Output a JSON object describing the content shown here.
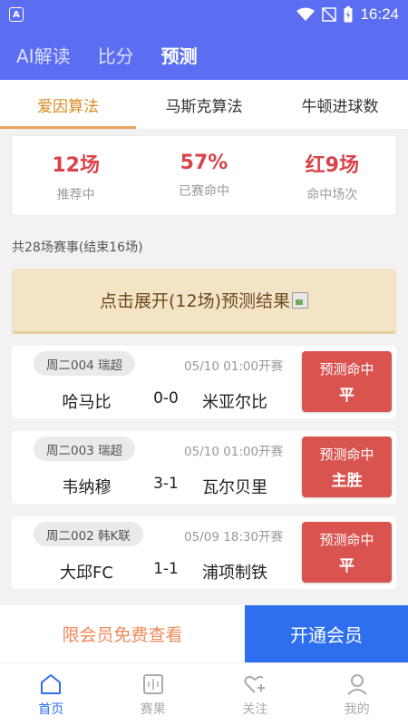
{
  "status_bar": {
    "time": "16:24",
    "app_icon": "A"
  },
  "header_tabs": [
    {
      "label": "AI解读"
    },
    {
      "label": "比分"
    },
    {
      "label": "预测"
    }
  ],
  "algo_tabs": [
    {
      "label": "爱因算法"
    },
    {
      "label": "马斯克算法"
    },
    {
      "label": "牛顿进球数"
    }
  ],
  "stats": [
    {
      "value": "12场",
      "label": "推荐中"
    },
    {
      "value": "57%",
      "label": "已赛命中"
    },
    {
      "value": "红9场",
      "label": "命中场次"
    }
  ],
  "summary": "共28场赛事(结束16场)",
  "expand_label": "点击展开(12场)预测结果",
  "matches": [
    {
      "tag": "周二004 瑞超",
      "time": "05/10 01:00开赛",
      "home": "哈马比",
      "score": "0-0",
      "away": "米亚尔比",
      "badge_title": "预测命中",
      "badge_result": "平"
    },
    {
      "tag": "周二003 瑞超",
      "time": "05/10 01:00开赛",
      "home": "韦纳穆",
      "score": "3-1",
      "away": "瓦尔贝里",
      "badge_title": "预测命中",
      "badge_result": "主胜"
    },
    {
      "tag": "周二002 韩K联",
      "time": "05/09 18:30开赛",
      "home": "大邱FC",
      "score": "1-1",
      "away": "浦项制铁",
      "badge_title": "预测命中",
      "badge_result": "平"
    }
  ],
  "cta": {
    "left": "限会员免费查看",
    "right": "开通会员"
  },
  "tabbar": [
    {
      "label": "首页",
      "icon": "home-icon"
    },
    {
      "label": "赛果",
      "icon": "scoreboard-icon"
    },
    {
      "label": "关注",
      "icon": "heart-plus-icon"
    },
    {
      "label": "我的",
      "icon": "user-icon"
    }
  ],
  "colors": {
    "brand": "#5b6ef2",
    "accent": "#2e6ff0",
    "hit_red": "#d9534f",
    "algo_active": "#d88b1f"
  }
}
